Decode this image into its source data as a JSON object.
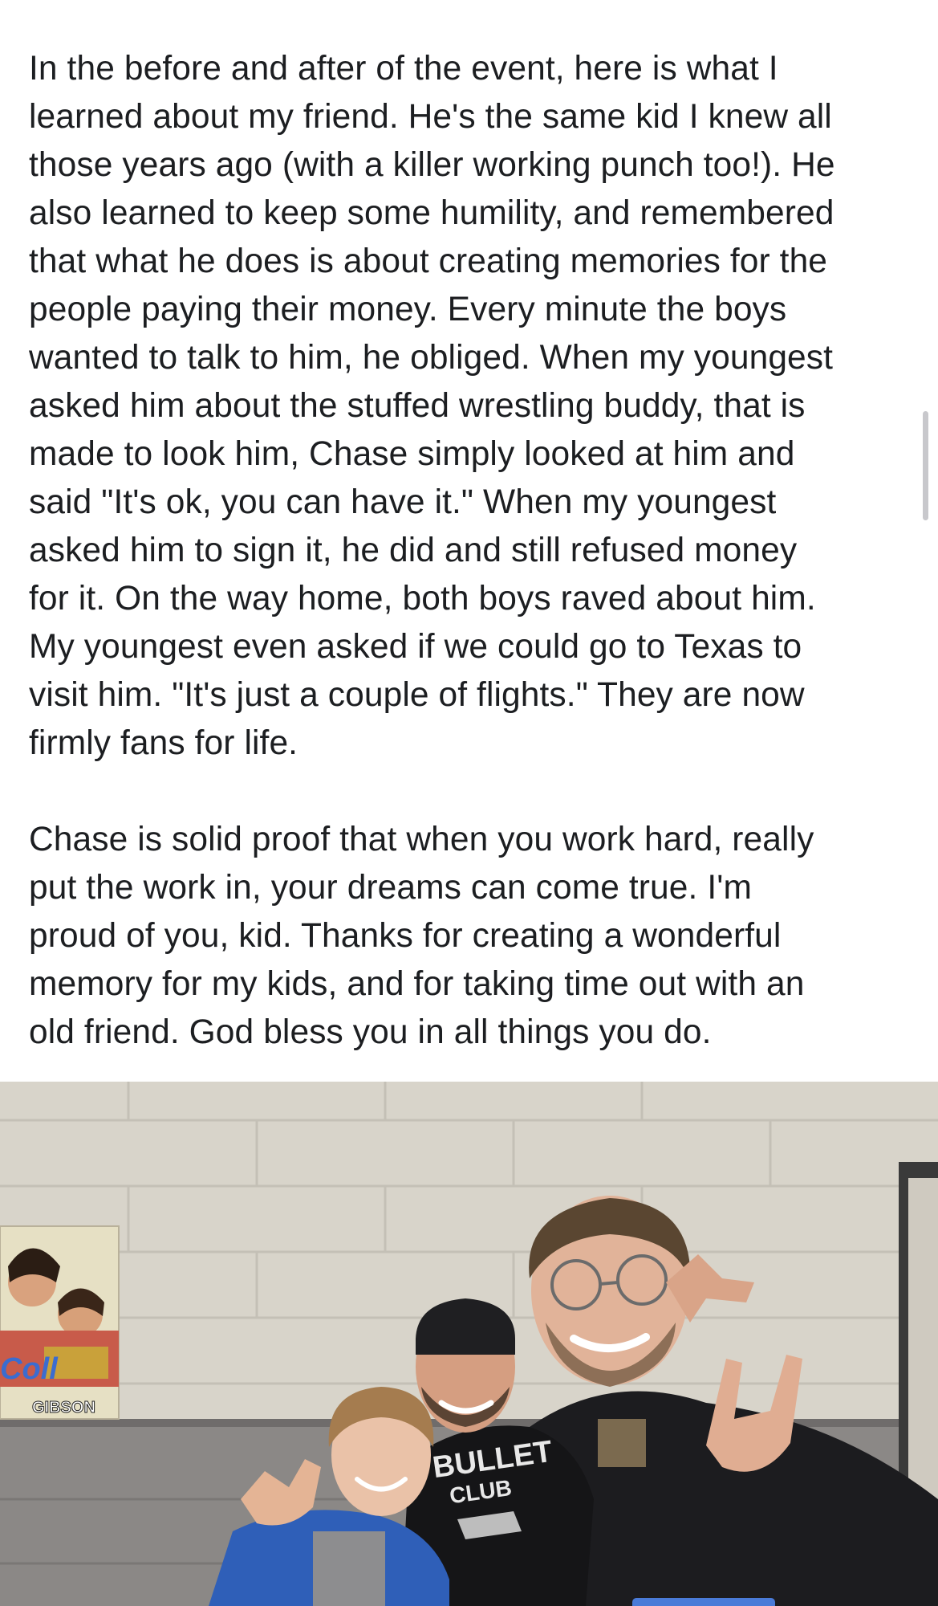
{
  "post": {
    "paragraph_1": [
      "In the before and after of the event, here is what I",
      "learned about my friend. He's the same kid I knew all",
      "those years ago (with a killer working punch too!). He",
      "also learned to keep some humility, and remembered",
      "that what he does is about creating memories for the",
      "people paying their money. Every minute the boys",
      "wanted to talk to him, he obliged. When my youngest",
      "asked him about the stuffed wrestling buddy, that is",
      "made to look him, Chase simply looked at him and",
      "said \"It's ok, you can have it.\" When my youngest",
      "asked him to sign it, he did and still refused money",
      "for it. On the way home, both boys raved about him.",
      "My youngest even asked if we could go to Texas to",
      "visit him. \"It's just a couple of flights.\" They are now",
      "firmly fans for life."
    ],
    "paragraph_2": [
      "Chase is solid proof that when you work hard, really",
      "put the work in, your dreams can come true. I'm",
      "proud of you, kid. Thanks for creating a wonderful",
      "memory for my kids, and for taking time out with an",
      "old friend. God bless you in all things you do."
    ]
  },
  "photo": {
    "poster_text_1": "GIBSON",
    "poster_text_2": "Coll",
    "shirt_text_1": "BULLET",
    "shirt_text_2": "CLUB"
  },
  "colors": {
    "text": "#1c1e21",
    "background": "#ffffff",
    "wall": "#d6d2c8",
    "wall_dark": "#8a8886",
    "accent_indicator": "#4a7bd8"
  }
}
